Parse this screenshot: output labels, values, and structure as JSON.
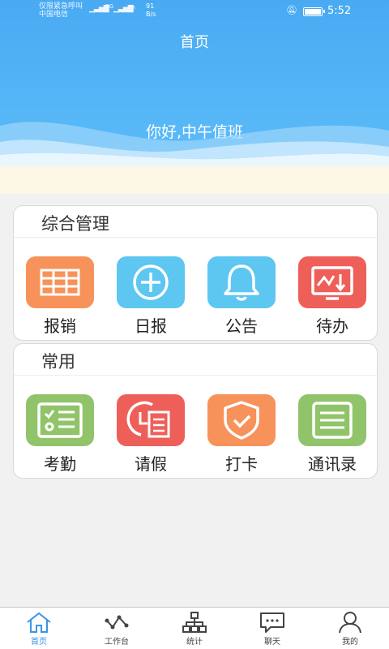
{
  "status_bar": {
    "carrier_line1": "仅限紧急呼叫",
    "carrier_line2": "中国电信",
    "network_type": "2G",
    "speed_value": "91",
    "speed_unit": "B/s",
    "time": "5:52"
  },
  "header": {
    "title": "首页",
    "greeting": "你好,中午值班"
  },
  "sections": [
    {
      "title": "综合管理",
      "items": [
        {
          "label": "报销",
          "icon": "table-icon",
          "color": "#f6925a"
        },
        {
          "label": "日报",
          "icon": "plus-circle-icon",
          "color": "#5dc6f1"
        },
        {
          "label": "公告",
          "icon": "bell-icon",
          "color": "#5dc6f1"
        },
        {
          "label": "待办",
          "icon": "monitor-icon",
          "color": "#ef5f5a"
        }
      ]
    },
    {
      "title": "常用",
      "items": [
        {
          "label": "考勤",
          "icon": "checklist-icon",
          "color": "#91c46a"
        },
        {
          "label": "请假",
          "icon": "leave-form-icon",
          "color": "#ef5f5a"
        },
        {
          "label": "打卡",
          "icon": "shield-check-icon",
          "color": "#f6925a"
        },
        {
          "label": "通讯录",
          "icon": "list-icon",
          "color": "#91c46a"
        }
      ]
    }
  ],
  "tab_bar": {
    "active": "首页",
    "tabs": [
      {
        "label": "首页",
        "icon": "home-icon"
      },
      {
        "label": "工作台",
        "icon": "workbench-icon"
      },
      {
        "label": "统计",
        "icon": "org-chart-icon"
      },
      {
        "label": "聊天",
        "icon": "chat-icon"
      },
      {
        "label": "我的",
        "icon": "person-icon"
      }
    ]
  },
  "colors": {
    "header_blue": "#49aaf3",
    "notice_bg": "#fdf8e6",
    "tab_active": "#3a95e6"
  }
}
